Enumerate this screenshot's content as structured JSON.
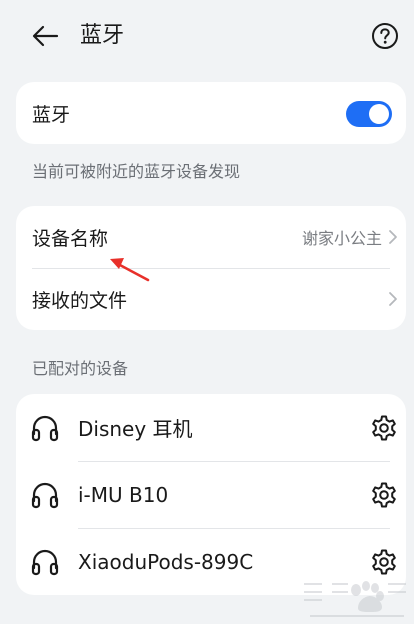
{
  "header": {
    "title": "蓝牙"
  },
  "bluetooth": {
    "label": "蓝牙",
    "enabled": true,
    "accent": "#1e6ef5"
  },
  "visibility_caption": "当前可被附近的蓝牙设备发现",
  "settings": {
    "device_name_label": "设备名称",
    "device_name_value": "谢家小公主",
    "received_files_label": "接收的文件"
  },
  "paired_caption": "已配对的设备",
  "paired_devices": [
    {
      "name": "Disney 耳机",
      "icon": "headphones-icon"
    },
    {
      "name": "i-MU B10",
      "icon": "headphones-icon"
    },
    {
      "name": "XiaoduPods-899C",
      "icon": "headphones-icon"
    }
  ]
}
